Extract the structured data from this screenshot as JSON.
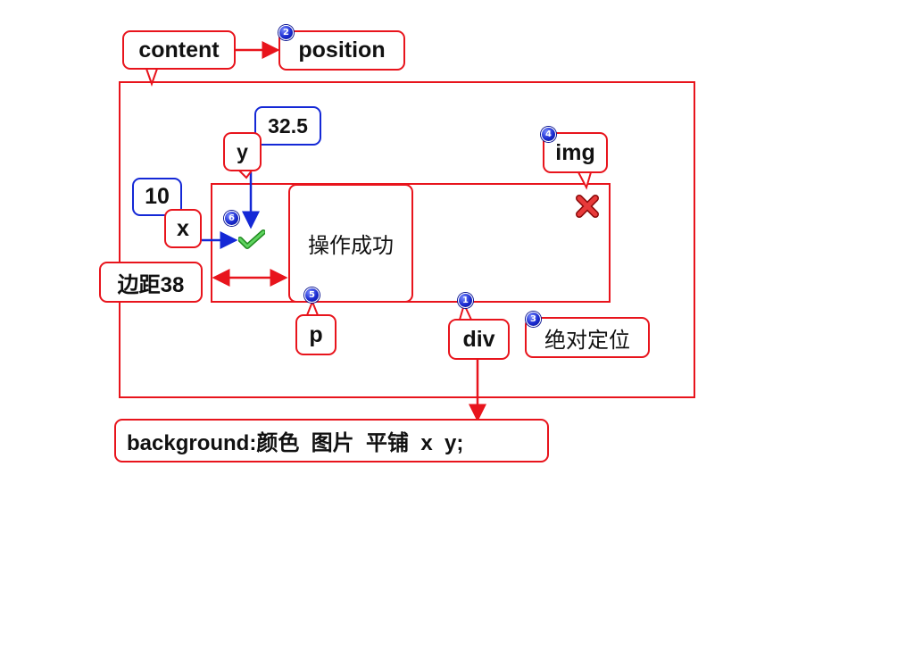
{
  "labels": {
    "content": "content",
    "position": "position",
    "y": "y",
    "y_value": "32.5",
    "x": "x",
    "x_value": "10",
    "img": "img",
    "margin": "边距38",
    "paragraph_text": "操作成功",
    "p": "p",
    "div": "div",
    "absolute": "绝对定位",
    "background": "background:颜色  图片  平铺  x  y;"
  },
  "badges": {
    "div": "1",
    "position": "2",
    "absolute": "3",
    "img": "4",
    "p": "5",
    "check": "6"
  },
  "colors": {
    "red": "#e8141c",
    "blue": "#1428d6",
    "check": "#2fb52f"
  },
  "icons": {
    "check": "check-icon",
    "close": "close-icon"
  }
}
